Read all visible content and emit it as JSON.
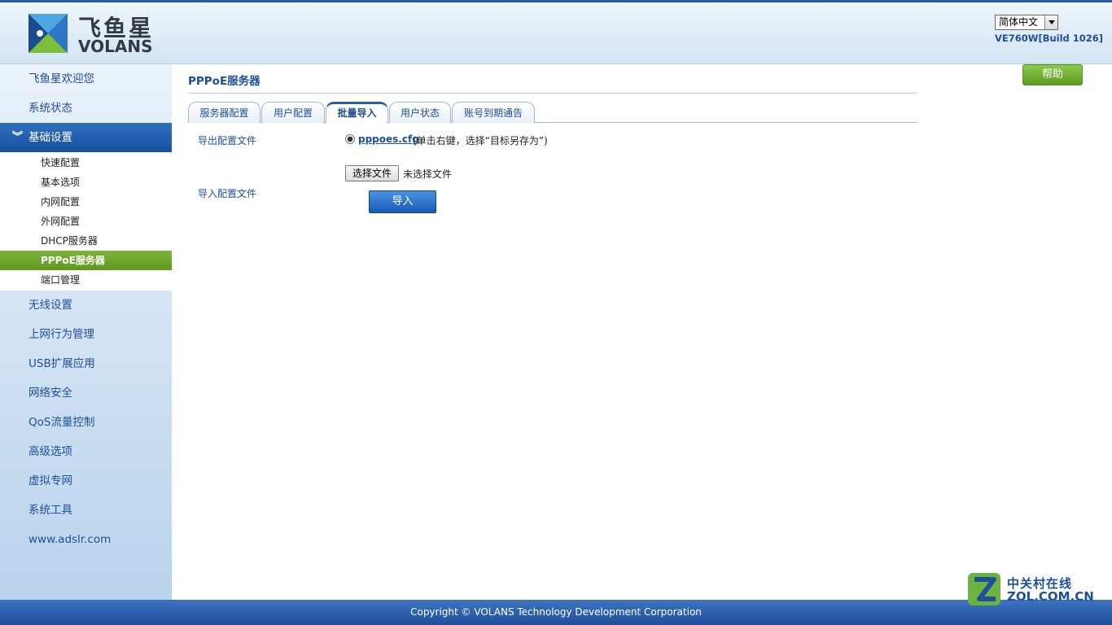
{
  "header": {
    "logo_cn": "飞鱼星",
    "logo_en": "VOLANS",
    "language": "简体中文",
    "version": "VE760W[Build 1026]"
  },
  "sidebar": {
    "items": [
      {
        "label": "飞鱼星欢迎您"
      },
      {
        "label": "系统状态"
      },
      {
        "label": "基础设置",
        "expanded": true
      },
      {
        "label": "无线设置"
      },
      {
        "label": "上网行为管理"
      },
      {
        "label": "USB扩展应用"
      },
      {
        "label": "网络安全"
      },
      {
        "label": "QoS流量控制"
      },
      {
        "label": "高级选项"
      },
      {
        "label": "虚拟专网"
      },
      {
        "label": "系统工具"
      },
      {
        "label": "www.adslr.com"
      }
    ],
    "sub_items": [
      {
        "label": "快速配置"
      },
      {
        "label": "基本选项"
      },
      {
        "label": "内网配置"
      },
      {
        "label": "外网配置"
      },
      {
        "label": "DHCP服务器"
      },
      {
        "label": "PPPoE服务器",
        "active": true
      },
      {
        "label": "端口管理"
      }
    ]
  },
  "main": {
    "title": "PPPoE服务器",
    "help_label": "帮助",
    "tabs": [
      {
        "label": "服务器配置"
      },
      {
        "label": "用户配置"
      },
      {
        "label": "批量导入",
        "active": true
      },
      {
        "label": "用户状态"
      },
      {
        "label": "账号到期通告"
      }
    ],
    "export_label": "导出配置文件",
    "export_file": "pppoes.cfg",
    "export_hint": "(单击右键，选择“目标另存为”)",
    "import_label": "导入配置文件",
    "choose_file_label": "选择文件",
    "no_file_label": "未选择文件",
    "import_button": "导入"
  },
  "footer": {
    "copyright": "Copyright © VOLANS Technology Development Corporation"
  },
  "watermark": {
    "cn": "中关村在线",
    "en": "ZOL.COM.CN"
  },
  "colors": {
    "brand_blue": "#1c4f9c",
    "active_green": "#6aa52a",
    "nav_active_blue": "#2463b3"
  }
}
